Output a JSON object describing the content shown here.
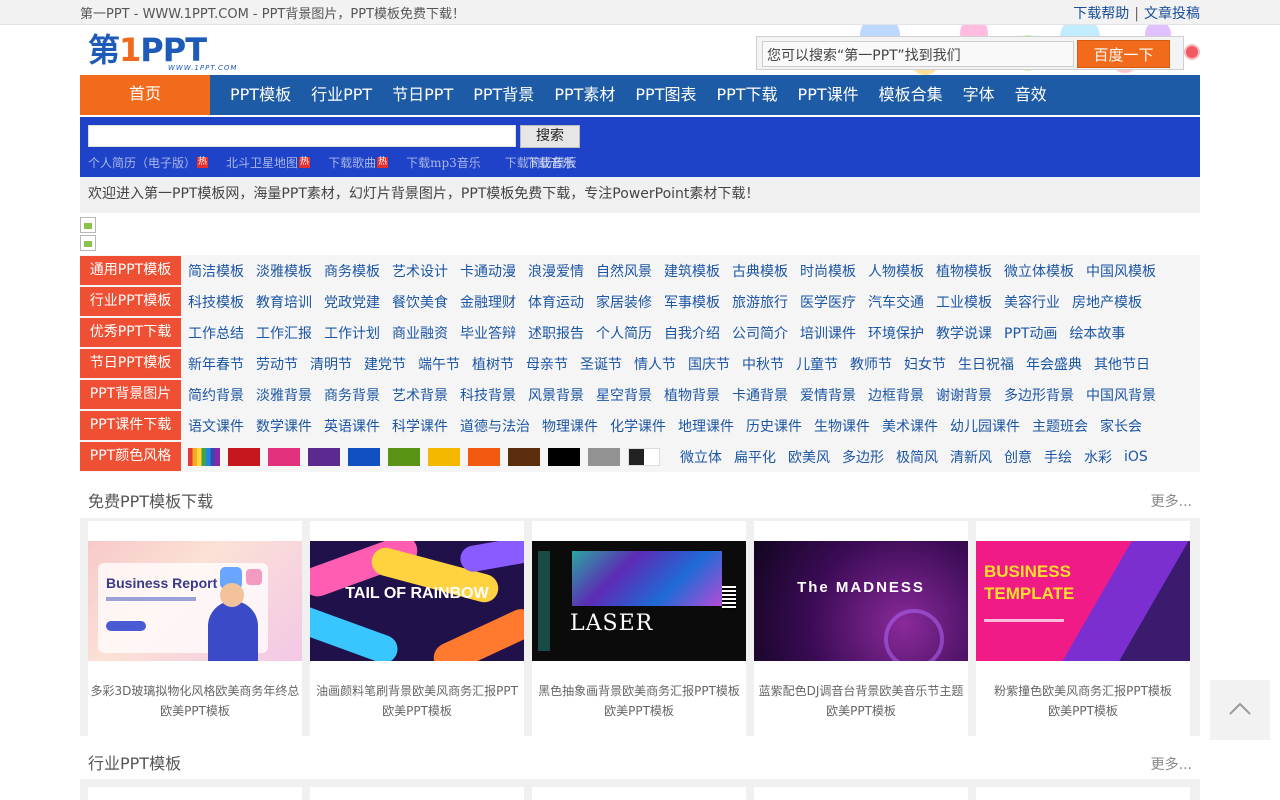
{
  "topbar": {
    "site_title": "第一PPT - WWW.1PPT.COM - PPT背景图片，PPT模板免费下载！",
    "help": "下载帮助",
    "sep": "|",
    "submit": "文章投稿"
  },
  "logo": {
    "text_a": "第",
    "text_one": "1",
    "text_b": "PPT",
    "sub": "WWW.1PPT.COM"
  },
  "search": {
    "placeholder": "您可以搜索“第一PPT”找到我们",
    "button": "百度一下"
  },
  "nav": {
    "home": "首页",
    "items": [
      "PPT模板",
      "行业PPT",
      "节日PPT",
      "PPT背景",
      "PPT素材",
      "PPT图表",
      "PPT下载",
      "PPT课件",
      "模板合集",
      "字体",
      "音效"
    ]
  },
  "keyword_bar": {
    "button": "搜索",
    "hot": [
      "个人简历（电子版）",
      "北斗卫星地图",
      "下载歌曲",
      "下载mp3音乐"
    ],
    "hot_badge": "热",
    "overlap_a": "下载简历模板",
    "overlap_b": "下载音乐"
  },
  "welcome": "欢迎进入第一PPT模板网，海量PPT素材，幻灯片背景图片，PPT模板免费下载，专注PowerPoint素材下载！",
  "categories": [
    {
      "label": "通用PPT模板",
      "links": [
        "简洁模板",
        "淡雅模板",
        "商务模板",
        "艺术设计",
        "卡通动漫",
        "浪漫爱情",
        "自然风景",
        "建筑模板",
        "古典模板",
        "时尚模板",
        "人物模板",
        "植物模板",
        "微立体模板",
        "中国风模板"
      ]
    },
    {
      "label": "行业PPT模板",
      "links": [
        "科技模板",
        "教育培训",
        "党政党建",
        "餐饮美食",
        "金融理财",
        "体育运动",
        "家居装修",
        "军事模板",
        "旅游旅行",
        "医学医疗",
        "汽车交通",
        "工业模板",
        "美容行业",
        "房地产模板"
      ]
    },
    {
      "label": "优秀PPT下载",
      "links": [
        "工作总结",
        "工作汇报",
        "工作计划",
        "商业融资",
        "毕业答辩",
        "述职报告",
        "个人简历",
        "自我介绍",
        "公司简介",
        "培训课件",
        "环境保护",
        "教学说课",
        "PPT动画",
        "绘本故事"
      ]
    },
    {
      "label": "节日PPT模板",
      "links": [
        "新年春节",
        "劳动节",
        "清明节",
        "建党节",
        "端午节",
        "植树节",
        "母亲节",
        "圣诞节",
        "情人节",
        "国庆节",
        "中秋节",
        "儿童节",
        "教师节",
        "妇女节",
        "生日祝福",
        "年会盛典",
        "其他节日"
      ]
    },
    {
      "label": "PPT背景图片",
      "links": [
        "简约背景",
        "淡雅背景",
        "商务背景",
        "艺术背景",
        "科技背景",
        "风景背景",
        "星空背景",
        "植物背景",
        "卡通背景",
        "爱情背景",
        "边框背景",
        "谢谢背景",
        "多边形背景",
        "中国风背景"
      ]
    },
    {
      "label": "PPT课件下载",
      "links": [
        "语文课件",
        "数学课件",
        "英语课件",
        "科学课件",
        "道德与法治",
        "物理课件",
        "化学课件",
        "地理课件",
        "历史课件",
        "生物课件",
        "美术课件",
        "幼儿园课件",
        "主题班会",
        "家长会"
      ]
    }
  ],
  "color_row": {
    "label": "PPT颜色风格",
    "swatches": [
      "rainbow",
      "#c4161c",
      "#e3307a",
      "#5b2a8e",
      "#1050c0",
      "#5a9416",
      "#f5b800",
      "#f25a12",
      "#5a2d0c",
      "#000000",
      "#939393",
      "black-white"
    ],
    "styles": [
      "微立体",
      "扁平化",
      "欧美风",
      "多边形",
      "极简风",
      "清新风",
      "创意",
      "手绘",
      "水彩",
      "iOS"
    ]
  },
  "section_free": {
    "title": "免费PPT模板下载",
    "more": "更多...",
    "cards": [
      {
        "line1": "多彩3D玻璃拟物化风格欧美商务年终总",
        "line2": "欧美PPT模板",
        "thumb_text": "Business Report"
      },
      {
        "line1": "油画颜料笔刷背景欧美风商务汇报PPT",
        "line2": "欧美PPT模板",
        "thumb_text": "TAIL OF RAINBOW"
      },
      {
        "line1": "黑色抽象画背景欧美商务汇报PPT模板",
        "line2": "欧美PPT模板",
        "thumb_text": "LASER"
      },
      {
        "line1": "蓝紫配色DJ调音台背景欧美音乐节主题",
        "line2": "欧美PPT模板",
        "thumb_text": "The MADNESS"
      },
      {
        "line1": "粉紫撞色欧美风商务汇报PPT模板",
        "line2": "欧美PPT模板",
        "thumb_text": "BUSINESS TEMPLATE"
      }
    ]
  },
  "section_industry": {
    "title": "行业PPT模板",
    "more": "更多..."
  }
}
